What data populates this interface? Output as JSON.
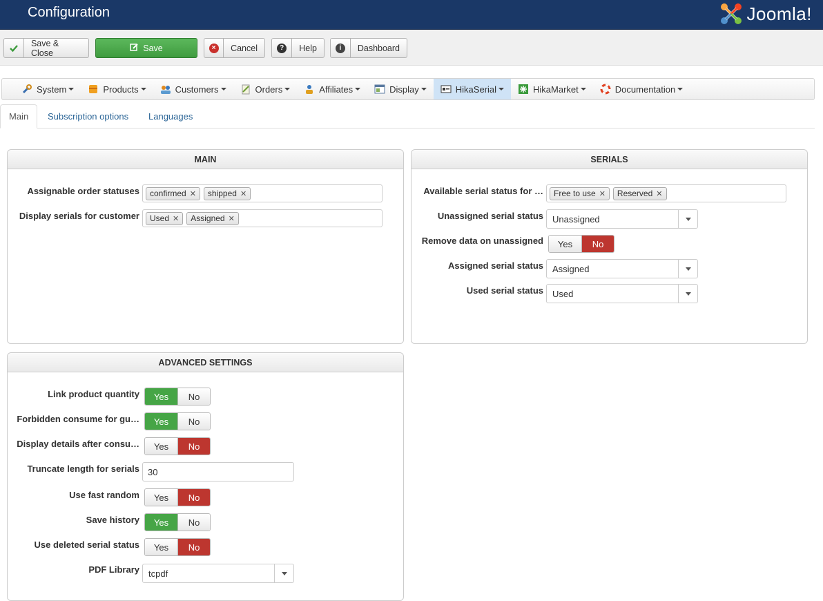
{
  "header": {
    "title": "Configuration",
    "logo_text": "Joomla!"
  },
  "toolbar": {
    "save_close": "Save & Close",
    "save": "Save",
    "cancel": "Cancel",
    "help": "Help",
    "dashboard": "Dashboard"
  },
  "menu": {
    "items": [
      {
        "label": "System",
        "icon": "wrench-icon"
      },
      {
        "label": "Products",
        "icon": "products-icon"
      },
      {
        "label": "Customers",
        "icon": "customers-icon"
      },
      {
        "label": "Orders",
        "icon": "orders-icon"
      },
      {
        "label": "Affiliates",
        "icon": "affiliates-icon"
      },
      {
        "label": "Display",
        "icon": "display-icon"
      },
      {
        "label": "HikaSerial",
        "icon": "hikaserial-icon"
      },
      {
        "label": "HikaMarket",
        "icon": "hikamarket-icon"
      },
      {
        "label": "Documentation",
        "icon": "lifebuoy-icon"
      }
    ],
    "active": "HikaSerial"
  },
  "tabs": {
    "main": "Main",
    "subscription": "Subscription options",
    "languages": "Languages"
  },
  "main_panel": {
    "title": "MAIN",
    "assignable_label": "Assignable order statuses",
    "assignable_tags": [
      "confirmed",
      "shipped"
    ],
    "display_label": "Display serials for customer",
    "display_tags": [
      "Used",
      "Assigned"
    ]
  },
  "serials_panel": {
    "title": "SERIALS",
    "available_label": "Available serial status for …",
    "available_tags": [
      "Free to use",
      "Reserved"
    ],
    "unassigned_label": "Unassigned serial status",
    "unassigned_value": "Unassigned",
    "remove_label": "Remove data on unassigned",
    "remove_value": "No",
    "assigned_label": "Assigned serial status",
    "assigned_value": "Assigned",
    "used_label": "Used serial status",
    "used_value": "Used"
  },
  "advanced_panel": {
    "title": "ADVANCED SETTINGS",
    "link_qty_label": "Link product quantity",
    "link_qty_value": "Yes",
    "forbidden_label": "Forbidden consume for gu…",
    "forbidden_value": "Yes",
    "display_details_label": "Display details after consu…",
    "display_details_value": "No",
    "truncate_label": "Truncate length for serials",
    "truncate_value": "30",
    "fast_random_label": "Use fast random",
    "fast_random_value": "No",
    "save_history_label": "Save history",
    "save_history_value": "Yes",
    "deleted_status_label": "Use deleted serial status",
    "deleted_status_value": "No",
    "pdf_label": "PDF Library",
    "pdf_value": "tcpdf"
  },
  "toggle_labels": {
    "yes": "Yes",
    "no": "No"
  },
  "colors": {
    "header": "#1a3867",
    "green": "#46a546",
    "red": "#bd362f",
    "link": "#2a6496"
  }
}
